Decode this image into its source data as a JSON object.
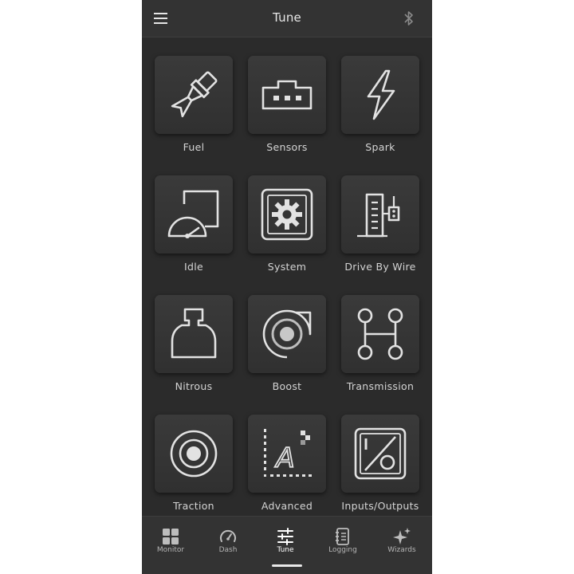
{
  "header": {
    "title": "Tune",
    "menu_icon": "hamburger-menu-icon",
    "status_icon": "bluetooth-icon"
  },
  "colors": {
    "background": "#2b2b2b",
    "bar": "#333333",
    "tile": "#363636",
    "icon_stroke": "#e2e2e2",
    "text": "#d4d4d4"
  },
  "tiles": [
    {
      "label": "Fuel",
      "icon": "fuel-injector-icon"
    },
    {
      "label": "Sensors",
      "icon": "sensor-connector-icon"
    },
    {
      "label": "Spark",
      "icon": "lightning-bolt-icon"
    },
    {
      "label": "Idle",
      "icon": "idle-gauge-icon"
    },
    {
      "label": "System",
      "icon": "system-gear-icon"
    },
    {
      "label": "Drive By Wire",
      "icon": "throttle-body-icon"
    },
    {
      "label": "Nitrous",
      "icon": "nitrous-bottle-icon"
    },
    {
      "label": "Boost",
      "icon": "turbo-icon"
    },
    {
      "label": "Transmission",
      "icon": "shifter-pattern-icon"
    },
    {
      "label": "Traction",
      "icon": "traction-target-icon"
    },
    {
      "label": "Advanced",
      "icon": "advanced-chart-icon"
    },
    {
      "label": "Inputs/Outputs",
      "icon": "inputs-outputs-icon"
    }
  ],
  "bottom_nav": [
    {
      "label": "Monitor",
      "icon": "monitor-grid-icon"
    },
    {
      "label": "Dash",
      "icon": "dash-gauge-icon"
    },
    {
      "label": "Tune",
      "icon": "tune-sliders-icon",
      "active": true
    },
    {
      "label": "Logging",
      "icon": "logging-notebook-icon"
    },
    {
      "label": "Wizards",
      "icon": "wizards-sparkle-icon"
    }
  ]
}
